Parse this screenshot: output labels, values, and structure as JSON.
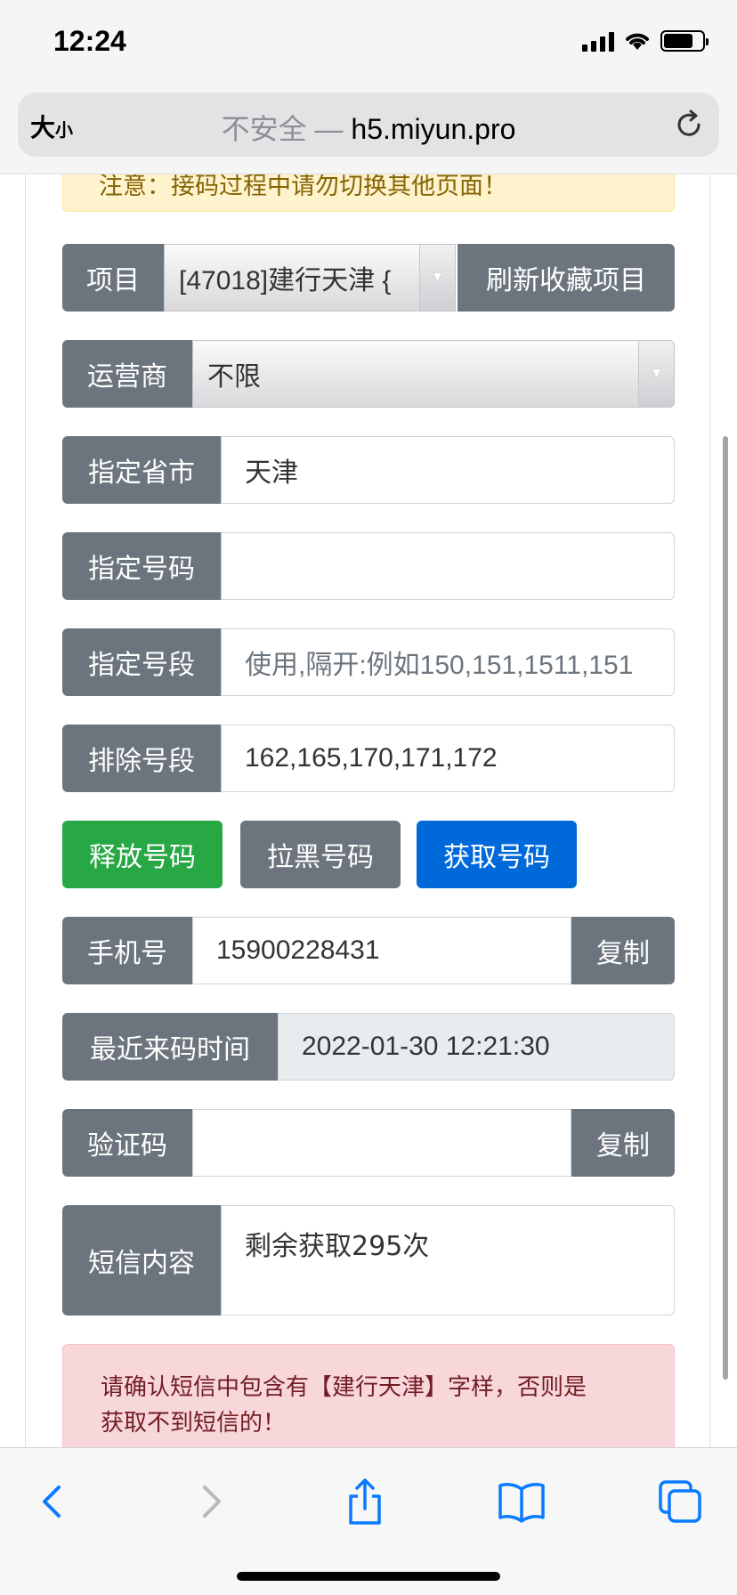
{
  "status_bar": {
    "time": "12:24"
  },
  "browser": {
    "reader_label_big": "大",
    "reader_label_small": "小",
    "insecure_label": "不安全",
    "separator": "—",
    "host": "h5.miyun.pro"
  },
  "page": {
    "warning_notice": "注意：接码过程中请勿切换其他页面！",
    "project": {
      "label": "项目",
      "selected": "[47018]建行天津 {",
      "refresh_button": "刷新收藏项目"
    },
    "carrier": {
      "label": "运营商",
      "selected": "不限"
    },
    "province": {
      "label": "指定省市",
      "value": "天津"
    },
    "number": {
      "label": "指定号码",
      "value": ""
    },
    "segment": {
      "label": "指定号段",
      "placeholder": "使用,隔开:例如150,151,1511,151"
    },
    "exclude": {
      "label": "排除号段",
      "value": "162,165,170,171,172"
    },
    "actions": {
      "release": "释放号码",
      "blacklist": "拉黑号码",
      "get": "获取号码"
    },
    "phone": {
      "label": "手机号",
      "value": "15900228431",
      "copy": "复制"
    },
    "last_time": {
      "label": "最近来码时间",
      "value": "2022-01-30 12:21:30"
    },
    "code": {
      "label": "验证码",
      "value": "",
      "copy": "复制"
    },
    "sms": {
      "label": "短信内容",
      "value": "剩余获取295次"
    },
    "danger_notice_line1": "请确认短信中包含有【建行天津】字样，否则是",
    "danger_notice_line2": "获取不到短信的！"
  },
  "colors": {
    "addon_gray": "#6c757d",
    "success_green": "#28a745",
    "primary_blue": "#0069d9",
    "ios_blue": "#0a7aff"
  },
  "toolbar_icons": [
    "back-icon",
    "forward-icon",
    "share-icon",
    "bookmarks-icon",
    "tabs-icon"
  ]
}
